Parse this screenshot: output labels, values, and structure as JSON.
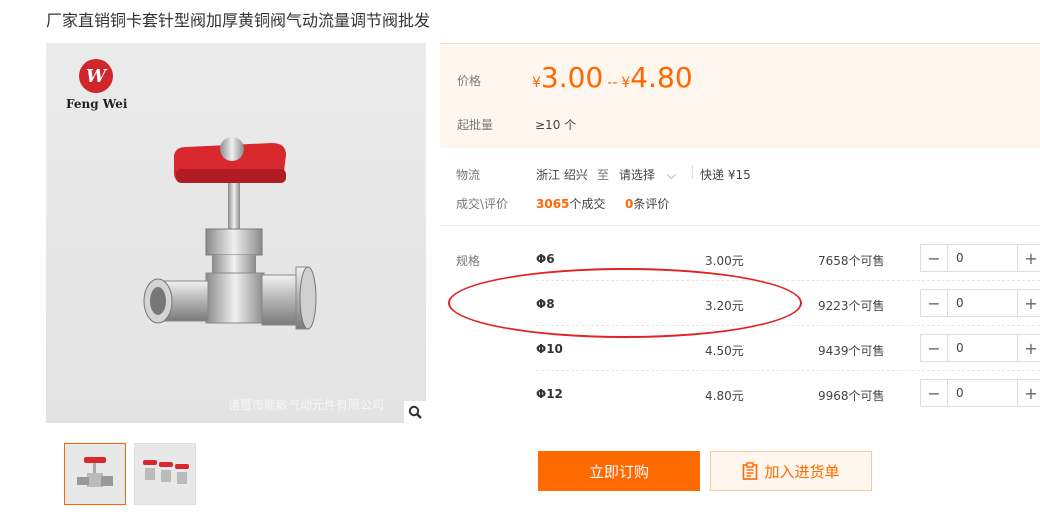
{
  "title": "厂家直销铜卡套针型阀加厚黄铜阀气动流量调节阀批发",
  "image": {
    "brand": "Feng Wei",
    "watermark": "诸暨市能敏气动元件有限公司",
    "zoom_icon": "magnifier-icon",
    "thumbnail_count": 2
  },
  "price": {
    "label": "价格",
    "currency": "¥",
    "low": "3.00",
    "separator": "--",
    "high": "4.80",
    "moq_label": "起批量",
    "moq_value": "≥10 个"
  },
  "logistics": {
    "label": "物流",
    "origin": "浙江 绍兴",
    "to": "至",
    "dest": "请选择",
    "express": "快递 ¥15",
    "trade_label": "成交\\评价",
    "deals_count": "3065",
    "deals_suffix": "个成交",
    "reviews_count": "0",
    "reviews_suffix": "条评价"
  },
  "spec": {
    "label": "规格",
    "rows": [
      {
        "name": "Φ6",
        "price": "3.00元",
        "stock": "7658个可售",
        "qty": "0"
      },
      {
        "name": "Φ8",
        "price": "3.20元",
        "stock": "9223个可售",
        "qty": "0"
      },
      {
        "name": "Φ10",
        "price": "4.50元",
        "stock": "9439个可售",
        "qty": "0"
      },
      {
        "name": "Φ12",
        "price": "4.80元",
        "stock": "9968个可售",
        "qty": "0"
      }
    ],
    "highlighted_row": 1
  },
  "actions": {
    "order": "立即订购",
    "cart": "加入进货单"
  },
  "colors": {
    "accent": "#ff6600",
    "highlight": "#e02424",
    "valve_handle": "#d9272e"
  }
}
